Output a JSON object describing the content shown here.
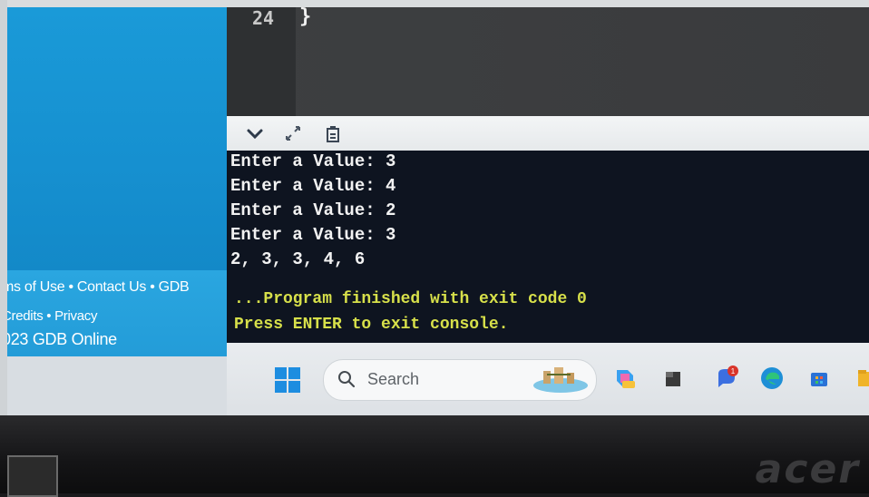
{
  "editor": {
    "line_number": "24",
    "code": "}"
  },
  "sidebar": {
    "footer_line1": "ms of Use • Contact Us • GDB",
    "footer_line2": "Credits • Privacy",
    "footer_line3": "023 GDB Online"
  },
  "console": {
    "toolbar_icons": [
      "chevron-down-icon",
      "expand-icon",
      "copy-clipboard-icon"
    ],
    "output_lines": [
      "Enter a Value: 3",
      "Enter a Value: 4",
      "Enter a Value: 2",
      "Enter a Value: 3",
      "2, 3, 3, 4, 6"
    ],
    "status_line1": "...Program finished with exit code 0",
    "status_line2": "Press ENTER to exit console."
  },
  "taskbar": {
    "search_label": "Search",
    "apps": [
      "copilot-icon",
      "file-explorer-icon",
      "chat-icon",
      "edge-icon",
      "store-icon",
      "folder-icon"
    ],
    "chat_badge": "1"
  },
  "brand": {
    "text": "acer"
  },
  "colors": {
    "sidebar_blue": "#1a9ad8",
    "console_bg": "#0e1420",
    "status_yellow": "#d7e04a"
  }
}
